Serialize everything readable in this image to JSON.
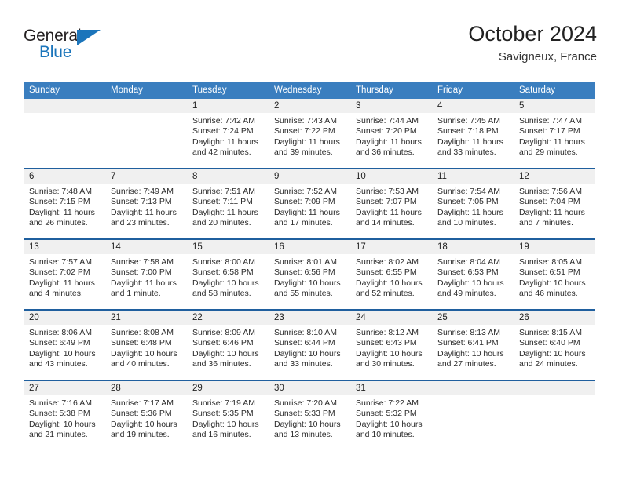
{
  "brand": {
    "name_part1": "General",
    "name_part2": "Blue",
    "color_dark": "#231f20",
    "color_blue": "#1b75bb"
  },
  "header": {
    "title": "October 2024",
    "subtitle": "Savigneux, France"
  },
  "theme": {
    "header_blue": "#3a7ebf",
    "rule_blue": "#1f5f9e",
    "day_band_gray": "#f0f0f0"
  },
  "weekdays": [
    "Sunday",
    "Monday",
    "Tuesday",
    "Wednesday",
    "Thursday",
    "Friday",
    "Saturday"
  ],
  "labels": {
    "sunrise_prefix": "Sunrise:",
    "sunset_prefix": "Sunset:",
    "daylight_prefix": "Daylight:"
  },
  "weeks": [
    [
      {
        "empty": true
      },
      {
        "empty": true
      },
      {
        "day": "1",
        "sunrise": "Sunrise: 7:42 AM",
        "sunset": "Sunset: 7:24 PM",
        "daylight_l1": "Daylight: 11 hours",
        "daylight_l2": "and 42 minutes."
      },
      {
        "day": "2",
        "sunrise": "Sunrise: 7:43 AM",
        "sunset": "Sunset: 7:22 PM",
        "daylight_l1": "Daylight: 11 hours",
        "daylight_l2": "and 39 minutes."
      },
      {
        "day": "3",
        "sunrise": "Sunrise: 7:44 AM",
        "sunset": "Sunset: 7:20 PM",
        "daylight_l1": "Daylight: 11 hours",
        "daylight_l2": "and 36 minutes."
      },
      {
        "day": "4",
        "sunrise": "Sunrise: 7:45 AM",
        "sunset": "Sunset: 7:18 PM",
        "daylight_l1": "Daylight: 11 hours",
        "daylight_l2": "and 33 minutes."
      },
      {
        "day": "5",
        "sunrise": "Sunrise: 7:47 AM",
        "sunset": "Sunset: 7:17 PM",
        "daylight_l1": "Daylight: 11 hours",
        "daylight_l2": "and 29 minutes."
      }
    ],
    [
      {
        "day": "6",
        "sunrise": "Sunrise: 7:48 AM",
        "sunset": "Sunset: 7:15 PM",
        "daylight_l1": "Daylight: 11 hours",
        "daylight_l2": "and 26 minutes."
      },
      {
        "day": "7",
        "sunrise": "Sunrise: 7:49 AM",
        "sunset": "Sunset: 7:13 PM",
        "daylight_l1": "Daylight: 11 hours",
        "daylight_l2": "and 23 minutes."
      },
      {
        "day": "8",
        "sunrise": "Sunrise: 7:51 AM",
        "sunset": "Sunset: 7:11 PM",
        "daylight_l1": "Daylight: 11 hours",
        "daylight_l2": "and 20 minutes."
      },
      {
        "day": "9",
        "sunrise": "Sunrise: 7:52 AM",
        "sunset": "Sunset: 7:09 PM",
        "daylight_l1": "Daylight: 11 hours",
        "daylight_l2": "and 17 minutes."
      },
      {
        "day": "10",
        "sunrise": "Sunrise: 7:53 AM",
        "sunset": "Sunset: 7:07 PM",
        "daylight_l1": "Daylight: 11 hours",
        "daylight_l2": "and 14 minutes."
      },
      {
        "day": "11",
        "sunrise": "Sunrise: 7:54 AM",
        "sunset": "Sunset: 7:05 PM",
        "daylight_l1": "Daylight: 11 hours",
        "daylight_l2": "and 10 minutes."
      },
      {
        "day": "12",
        "sunrise": "Sunrise: 7:56 AM",
        "sunset": "Sunset: 7:04 PM",
        "daylight_l1": "Daylight: 11 hours",
        "daylight_l2": "and 7 minutes."
      }
    ],
    [
      {
        "day": "13",
        "sunrise": "Sunrise: 7:57 AM",
        "sunset": "Sunset: 7:02 PM",
        "daylight_l1": "Daylight: 11 hours",
        "daylight_l2": "and 4 minutes."
      },
      {
        "day": "14",
        "sunrise": "Sunrise: 7:58 AM",
        "sunset": "Sunset: 7:00 PM",
        "daylight_l1": "Daylight: 11 hours",
        "daylight_l2": "and 1 minute."
      },
      {
        "day": "15",
        "sunrise": "Sunrise: 8:00 AM",
        "sunset": "Sunset: 6:58 PM",
        "daylight_l1": "Daylight: 10 hours",
        "daylight_l2": "and 58 minutes."
      },
      {
        "day": "16",
        "sunrise": "Sunrise: 8:01 AM",
        "sunset": "Sunset: 6:56 PM",
        "daylight_l1": "Daylight: 10 hours",
        "daylight_l2": "and 55 minutes."
      },
      {
        "day": "17",
        "sunrise": "Sunrise: 8:02 AM",
        "sunset": "Sunset: 6:55 PM",
        "daylight_l1": "Daylight: 10 hours",
        "daylight_l2": "and 52 minutes."
      },
      {
        "day": "18",
        "sunrise": "Sunrise: 8:04 AM",
        "sunset": "Sunset: 6:53 PM",
        "daylight_l1": "Daylight: 10 hours",
        "daylight_l2": "and 49 minutes."
      },
      {
        "day": "19",
        "sunrise": "Sunrise: 8:05 AM",
        "sunset": "Sunset: 6:51 PM",
        "daylight_l1": "Daylight: 10 hours",
        "daylight_l2": "and 46 minutes."
      }
    ],
    [
      {
        "day": "20",
        "sunrise": "Sunrise: 8:06 AM",
        "sunset": "Sunset: 6:49 PM",
        "daylight_l1": "Daylight: 10 hours",
        "daylight_l2": "and 43 minutes."
      },
      {
        "day": "21",
        "sunrise": "Sunrise: 8:08 AM",
        "sunset": "Sunset: 6:48 PM",
        "daylight_l1": "Daylight: 10 hours",
        "daylight_l2": "and 40 minutes."
      },
      {
        "day": "22",
        "sunrise": "Sunrise: 8:09 AM",
        "sunset": "Sunset: 6:46 PM",
        "daylight_l1": "Daylight: 10 hours",
        "daylight_l2": "and 36 minutes."
      },
      {
        "day": "23",
        "sunrise": "Sunrise: 8:10 AM",
        "sunset": "Sunset: 6:44 PM",
        "daylight_l1": "Daylight: 10 hours",
        "daylight_l2": "and 33 minutes."
      },
      {
        "day": "24",
        "sunrise": "Sunrise: 8:12 AM",
        "sunset": "Sunset: 6:43 PM",
        "daylight_l1": "Daylight: 10 hours",
        "daylight_l2": "and 30 minutes."
      },
      {
        "day": "25",
        "sunrise": "Sunrise: 8:13 AM",
        "sunset": "Sunset: 6:41 PM",
        "daylight_l1": "Daylight: 10 hours",
        "daylight_l2": "and 27 minutes."
      },
      {
        "day": "26",
        "sunrise": "Sunrise: 8:15 AM",
        "sunset": "Sunset: 6:40 PM",
        "daylight_l1": "Daylight: 10 hours",
        "daylight_l2": "and 24 minutes."
      }
    ],
    [
      {
        "day": "27",
        "sunrise": "Sunrise: 7:16 AM",
        "sunset": "Sunset: 5:38 PM",
        "daylight_l1": "Daylight: 10 hours",
        "daylight_l2": "and 21 minutes."
      },
      {
        "day": "28",
        "sunrise": "Sunrise: 7:17 AM",
        "sunset": "Sunset: 5:36 PM",
        "daylight_l1": "Daylight: 10 hours",
        "daylight_l2": "and 19 minutes."
      },
      {
        "day": "29",
        "sunrise": "Sunrise: 7:19 AM",
        "sunset": "Sunset: 5:35 PM",
        "daylight_l1": "Daylight: 10 hours",
        "daylight_l2": "and 16 minutes."
      },
      {
        "day": "30",
        "sunrise": "Sunrise: 7:20 AM",
        "sunset": "Sunset: 5:33 PM",
        "daylight_l1": "Daylight: 10 hours",
        "daylight_l2": "and 13 minutes."
      },
      {
        "day": "31",
        "sunrise": "Sunrise: 7:22 AM",
        "sunset": "Sunset: 5:32 PM",
        "daylight_l1": "Daylight: 10 hours",
        "daylight_l2": "and 10 minutes."
      },
      {
        "empty": true
      },
      {
        "empty": true
      }
    ]
  ]
}
